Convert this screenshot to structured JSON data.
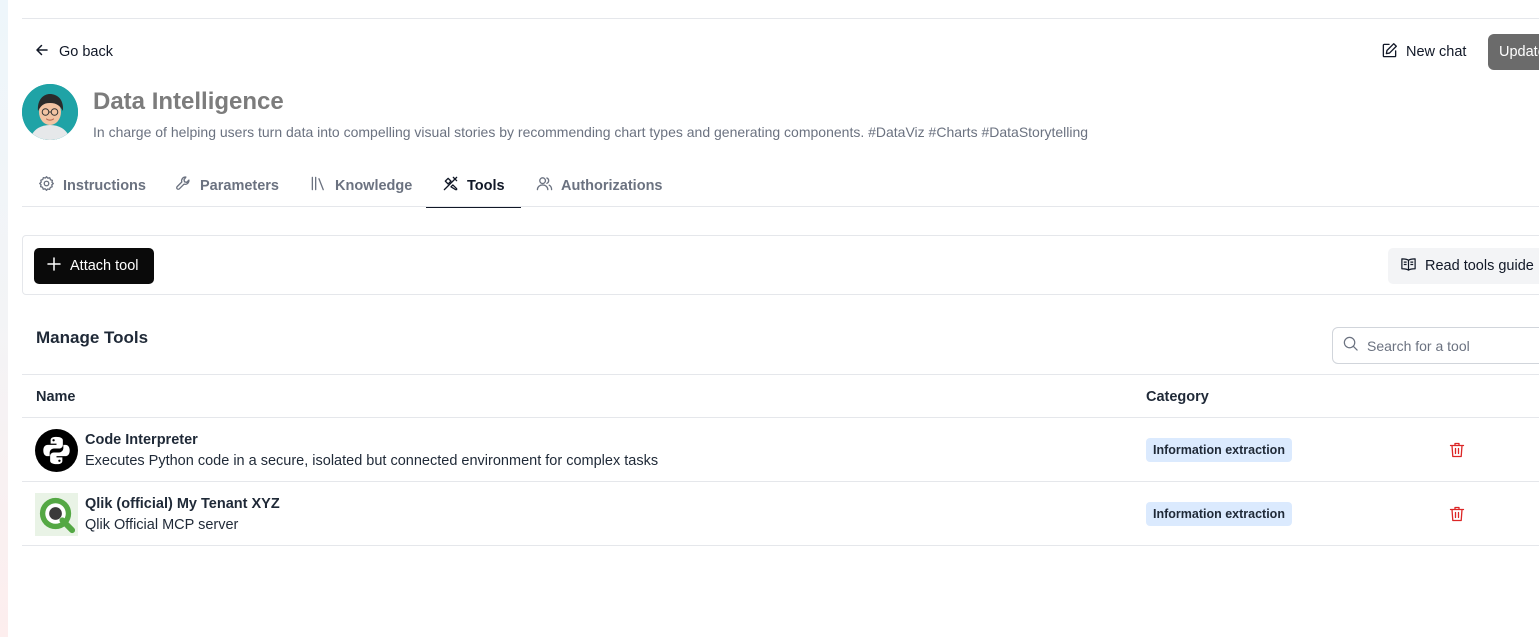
{
  "header": {
    "back_label": "Go back",
    "new_chat_label": "New chat",
    "update_label": "Update"
  },
  "agent": {
    "name": "Data Intelligence",
    "description": "In charge of helping users turn data into compelling visual stories by recommending chart types and generating components. #DataViz #Charts #DataStorytelling"
  },
  "tabs": [
    {
      "label": "Instructions",
      "icon": "gear-icon",
      "active": false
    },
    {
      "label": "Parameters",
      "icon": "wrench-icon",
      "active": false
    },
    {
      "label": "Knowledge",
      "icon": "library-icon",
      "active": false
    },
    {
      "label": "Tools",
      "icon": "tools-icon",
      "active": true
    },
    {
      "label": "Authorizations",
      "icon": "users-icon",
      "active": false
    }
  ],
  "toolbar": {
    "attach_label": "Attach tool",
    "guide_label": "Read tools guide"
  },
  "manage": {
    "title": "Manage Tools",
    "search_placeholder": "Search for a tool"
  },
  "table": {
    "columns": {
      "name": "Name",
      "category": "Category"
    },
    "rows": [
      {
        "name": "Code Interpreter",
        "description": "Executes Python code in a secure, isolated but connected environment for complex tasks",
        "category": "Information extraction",
        "icon": "python-icon"
      },
      {
        "name": "Qlik (official) My Tenant XYZ",
        "description": "Qlik Official MCP server",
        "category": "Information extraction",
        "icon": "qlik-icon"
      }
    ]
  },
  "colors": {
    "primary_button": "#0a0a0a",
    "update_button": "#6b6b6b",
    "badge_bg": "#dbeafe",
    "delete_icon": "#dc2626",
    "qlik_green": "#54a844"
  }
}
